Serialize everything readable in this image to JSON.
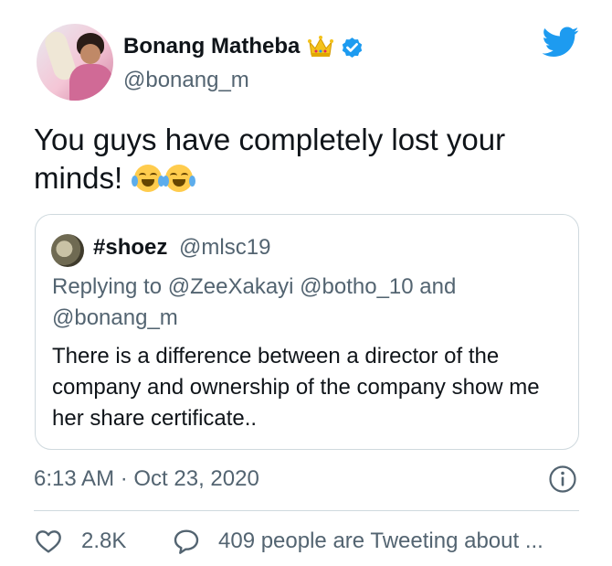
{
  "author": {
    "name": "Bonang Matheba",
    "handle": "@bonang_m"
  },
  "icons": {
    "avatar": "profile-photo",
    "crown": "crown-emoji",
    "verified": "verified-badge-icon",
    "logo": "twitter-bird-icon",
    "info": "info-icon",
    "like": "heart-icon",
    "reply": "speech-bubble-icon",
    "text_emoji": "tears-of-joy-emoji"
  },
  "tweet": {
    "text": "You guys have completely lost your minds!"
  },
  "quoted": {
    "name": "#shoez",
    "handle": "@mlsc19",
    "replying_to": "Replying to @ZeeXakayi @botho_10 and @bonang_m",
    "text": "There is a difference between a director of the company and ownership of the company show me her share certificate.."
  },
  "meta": {
    "timestamp": "6:13 AM · Oct 23, 2020"
  },
  "actions": {
    "likes": "2.8K",
    "tweeting_about": "409 people are Tweeting about ..."
  },
  "colors": {
    "twitter_blue": "#1d9bf0",
    "text": "#0f1419",
    "secondary": "#536471",
    "border": "#cfd9de"
  }
}
